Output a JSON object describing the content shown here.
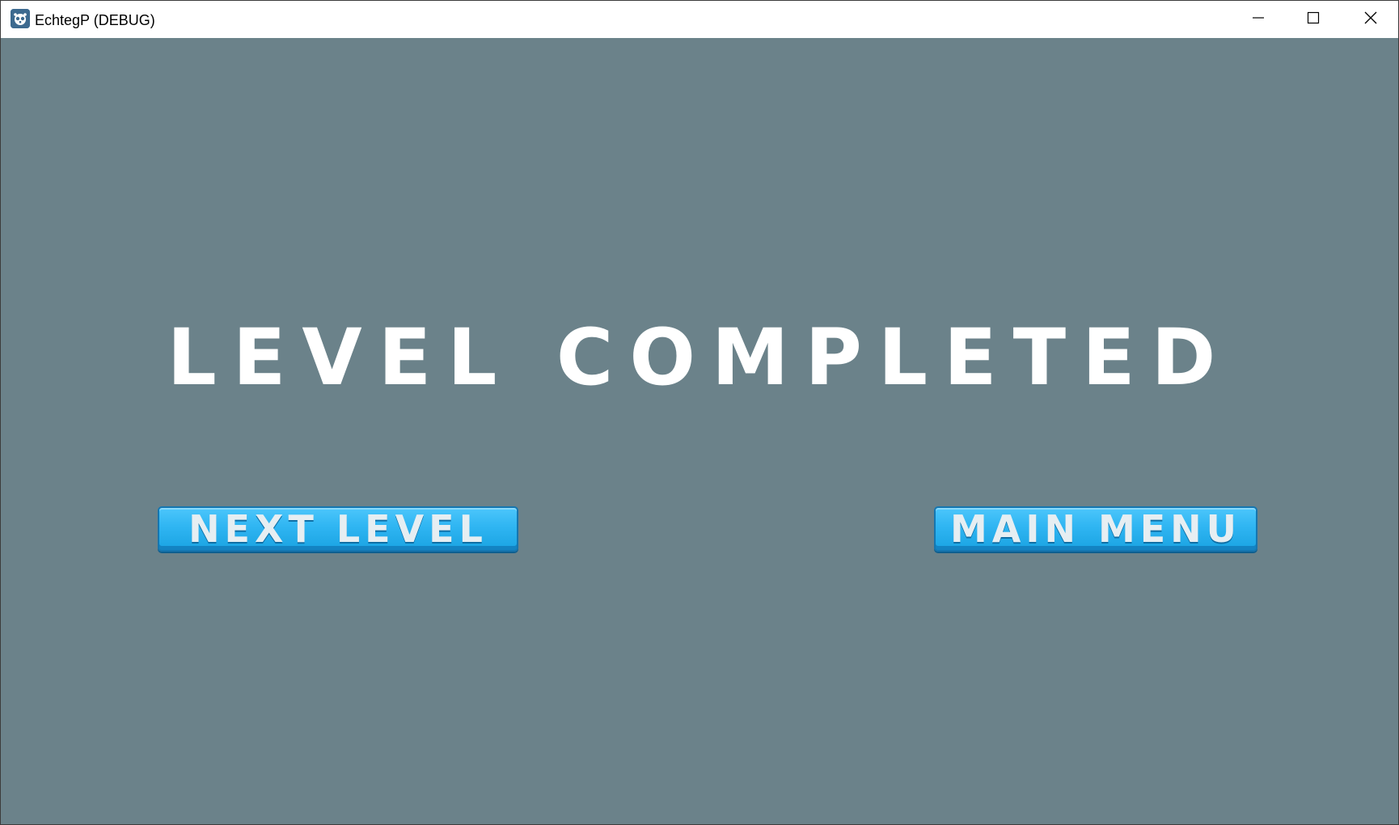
{
  "window": {
    "title": "EchtegP (DEBUG)",
    "icon": "godot-engine-icon",
    "controls": {
      "minimize": "minimize-icon",
      "maximize": "maximize-icon",
      "close": "close-icon"
    }
  },
  "screen": {
    "headline": "LEVEL COMPLETED",
    "buttons": {
      "next_level": "NEXT LEVEL",
      "main_menu": "MAIN MENU"
    }
  },
  "colors": {
    "background": "#6b828a",
    "headline": "#ffffff",
    "button": "#2fb5f2",
    "button_text": "#e6eef2"
  }
}
